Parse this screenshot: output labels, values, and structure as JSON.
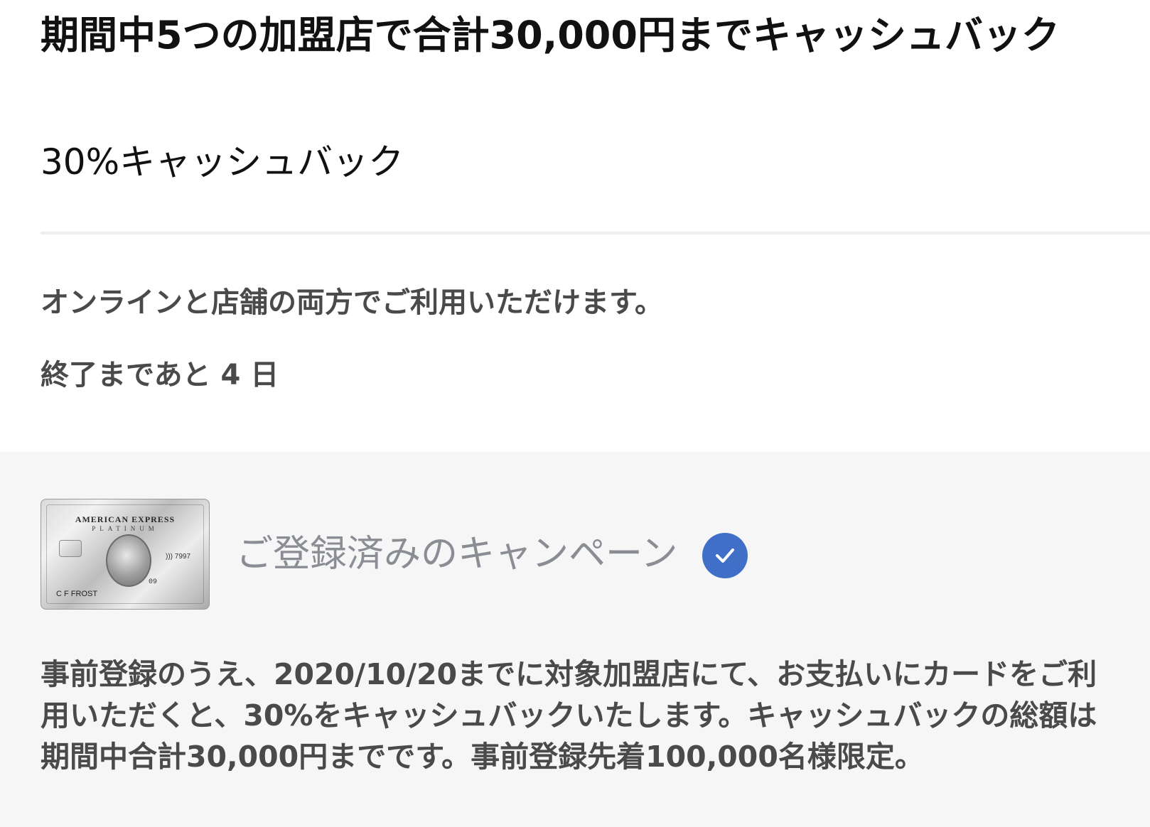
{
  "offer": {
    "title": "期間中5つの加盟店で合計30,000円までキャッシュバック",
    "subtitle": "30%キャッシュバック",
    "channel_note": "オンラインと店舗の両方でご利用いただけます。",
    "remaining": "終了まであと 4 日"
  },
  "enrollment": {
    "card": {
      "brand": "AMERICAN EXPRESS",
      "tier": "PLATINUM",
      "holder": "C F FROST",
      "number_fragment": "7997",
      "valid": "09"
    },
    "status_label": "ご登録済みのキャンペーン",
    "status_icon": "check-circle-icon",
    "terms": "事前登録のうえ、2020/10/20までに対象加盟店にて、お支払いにカードをご利用いただくと、30%をキャッシュバックいたします。キャッシュバックの総額は期間中合計30,000円までです。事前登録先着100,000名様限定。"
  },
  "colors": {
    "check_blue": "#3f6fc6",
    "panel_bg": "#f6f6f7",
    "muted_text": "#8a8d93"
  }
}
